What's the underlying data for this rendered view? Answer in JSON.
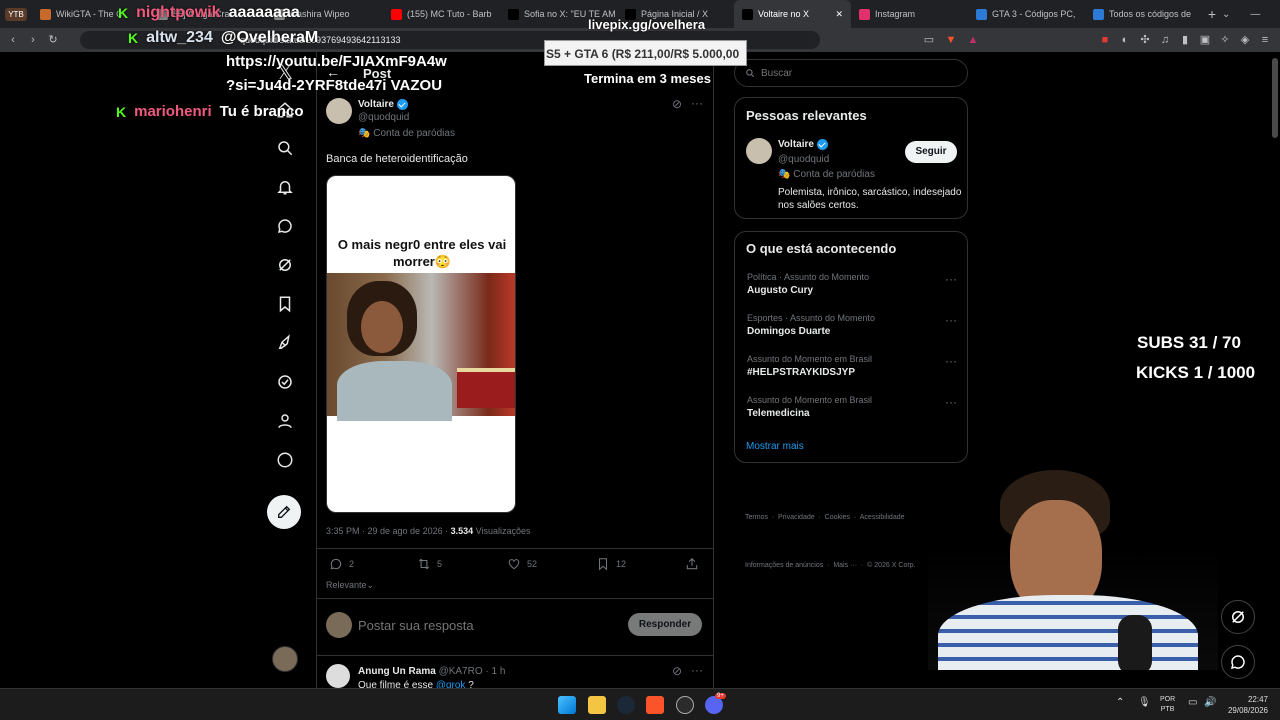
{
  "browser": {
    "tabs": [
      {
        "label": "WikiGTA - The C",
        "active": false,
        "color": "#c86b2a"
      },
      {
        "label": "55] A Liga Cra",
        "active": false,
        "color": "#888"
      },
      {
        "label": "Gashira Wipeo",
        "active": false,
        "color": "#888"
      },
      {
        "label": "(155) MC Tuto - Barb",
        "active": false,
        "color": "#ff0000"
      },
      {
        "label": "Sofia no X: \"EU TE AM",
        "active": false,
        "color": "#000"
      },
      {
        "label": "Página Inicial / X",
        "active": false,
        "color": "#000"
      },
      {
        "label": "Voltaire no X",
        "active": true,
        "color": "#000"
      },
      {
        "label": "Instagram",
        "active": false,
        "color": "#e1306c"
      },
      {
        "label": "GTA 3 - Códigos PC,",
        "active": false,
        "color": "#2d7bd6"
      },
      {
        "label": "Todos os códigos de",
        "active": false,
        "color": "#2d7bd6"
      }
    ],
    "profile_label": "YTB",
    "url": "quodquid/status/2093769493642113133"
  },
  "post_header": {
    "back_label": "←",
    "title": "Post"
  },
  "post": {
    "author_name": "Voltaire",
    "author_handle": "@quodquid",
    "parody_label": "Conta de paródias",
    "text": "Banca de heteroidentificação",
    "image_caption": "O mais negr0 entre eles vai morrer😳",
    "timestamp": "3:35 PM · 29 de ago de 2026 · ",
    "views_count": "3.534",
    "views_label": "Visualizações",
    "replies": "2",
    "reposts": "5",
    "likes": "52",
    "bookmarks": "12",
    "sort_label": "Relevante"
  },
  "reply_box": {
    "placeholder": "Postar sua resposta",
    "button": "Responder"
  },
  "reply": {
    "name": "Anung Un Rama",
    "handle": "@KA7RO",
    "time": "· 1 h",
    "text_prefix": "Que filme é esse ",
    "mention": "@grok",
    "text_suffix": " ?"
  },
  "search": {
    "placeholder": "Buscar"
  },
  "relevant": {
    "title": "Pessoas relevantes",
    "name": "Voltaire",
    "handle": "@quodquid",
    "parody": "Conta de paródias",
    "follow": "Seguir",
    "bio": "Polemista, irônico, sarcástico, indesejado nos salões certos."
  },
  "trending": {
    "title": "O que está acontecendo",
    "items": [
      {
        "context": "Política · Assunto do Momento",
        "topic": "Augusto Cury"
      },
      {
        "context": "Esportes · Assunto do Momento",
        "topic": "Domingos Duarte"
      },
      {
        "context": "Assunto do Momento em Brasil",
        "topic": "#HELPSTRAYKIDSJYP"
      },
      {
        "context": "Assunto do Momento em Brasil",
        "topic": "Telemedicina"
      }
    ],
    "show_more": "Mostrar mais"
  },
  "footer": {
    "line1": "Termos  ·  Privacidade  ·  Cookies  ·  Acessibilidade",
    "line2": "Informações de anúncios  ·  Mais ···  ·  © 2026 X Corp."
  },
  "overlay": {
    "chat1_user": "nightpowik",
    "chat1_msg": "aaaaaaaa",
    "chat2_user": "altw_234",
    "chat2_msg": "@OvelheraM",
    "chat2_link1": "https://youtu.be/FJIAXmF9A4w",
    "chat2_link2": "?si=Ju4d-2YRF8tde47i VAZOU",
    "chat3_user": "mariohenri",
    "chat3_msg": "Tu é branco",
    "livepix": "livepix.gg/ovelhera",
    "goal_bar": "S5 + GTA 6 (R$ 211,00/R$ 5.000,00",
    "goal_ends": "Termina em 3 meses",
    "subs": "SUBS 31 / 70",
    "kicks": "KICKS 1 / 1000"
  },
  "taskbar": {
    "lang1": "POR",
    "lang2": "PTB",
    "time": "22:47",
    "date": "29/08/2026",
    "discord_badge": "9+"
  },
  "colors": {
    "accent": "#1d9bf0",
    "kick_green": "#53fc18",
    "background": "#000000",
    "border": "#2f3336"
  }
}
